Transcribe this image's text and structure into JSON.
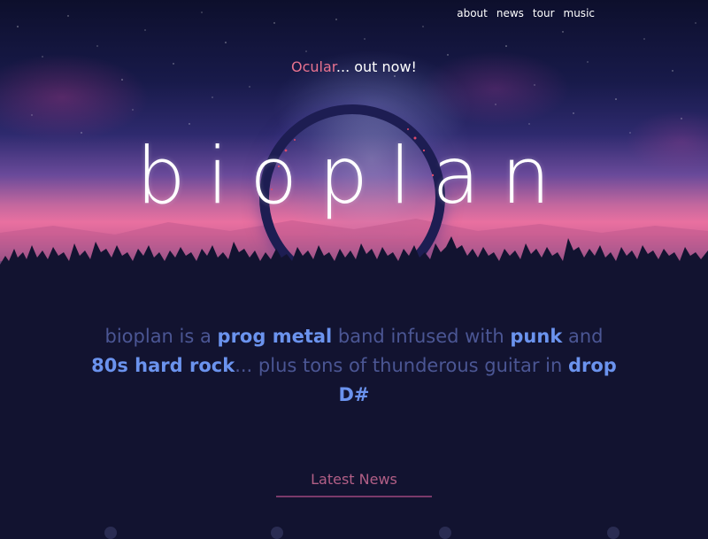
{
  "nav": {
    "items": [
      {
        "label": "about"
      },
      {
        "label": "news"
      },
      {
        "label": "tour"
      },
      {
        "label": "music"
      }
    ]
  },
  "release": {
    "album": "Ocular",
    "rest": "... out now!"
  },
  "logo": {
    "text": "bioplan"
  },
  "tagline": {
    "p1": "bioplan is a ",
    "h1": "prog metal",
    "p2": " band infused with ",
    "h2": "punk",
    "p3": " and ",
    "h3": "80s hard rock",
    "p4": "... plus tons of thunderous guitar in ",
    "h4": "drop D#"
  },
  "news": {
    "title": "Latest News"
  },
  "colors": {
    "background": "#121330",
    "accent_pink": "#e8728f",
    "accent_blue": "#6b93ee",
    "tagline_text": "#4b5694",
    "news_title": "#b25f86"
  }
}
